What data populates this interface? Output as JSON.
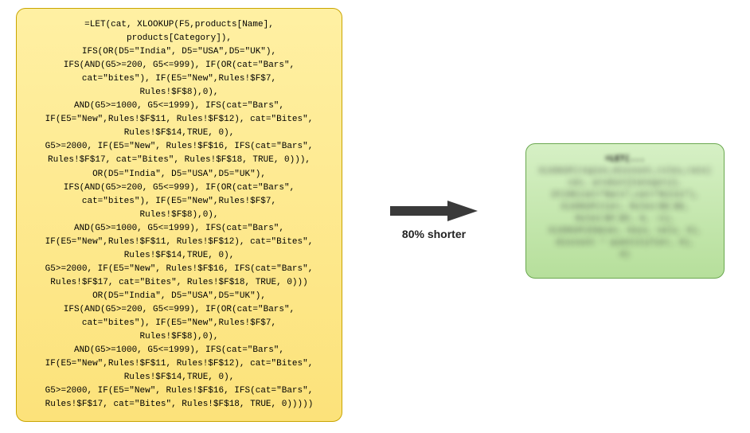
{
  "left_formula": {
    "lines": [
      "=LET(cat, XLOOKUP(F5,products[Name],",
      "products[Category]),",
      "IFS(OR(D5=\"India\", D5=\"USA\",D5=\"UK\"),",
      "IFS(AND(G5>=200, G5<=999), IF(OR(cat=\"Bars\",",
      "cat=\"bites\"), IF(E5=\"New\",Rules!$F$7,",
      "Rules!$F$8),0),",
      "AND(G5>=1000, G5<=1999), IFS(cat=\"Bars\",",
      "IF(E5=\"New\",Rules!$F$11, Rules!$F$12), cat=\"Bites\",",
      "Rules!$F$14,TRUE, 0),",
      "G5>=2000, IF(E5=\"New\", Rules!$F$16, IFS(cat=\"Bars\",",
      "Rules!$F$17, cat=\"Bites\", Rules!$F$18, TRUE, 0))),",
      "OR(D5=\"India\", D5=\"USA\",D5=\"UK\"),",
      "IFS(AND(G5>=200, G5<=999), IF(OR(cat=\"Bars\",",
      "cat=\"bites\"), IF(E5=\"New\",Rules!$F$7,",
      "Rules!$F$8),0),",
      "AND(G5>=1000, G5<=1999), IFS(cat=\"Bars\",",
      "IF(E5=\"New\",Rules!$F$11, Rules!$F$12), cat=\"Bites\",",
      "Rules!$F$14,TRUE, 0),",
      "G5>=2000, IF(E5=\"New\", Rules!$F$16, IFS(cat=\"Bars\",",
      "Rules!$F$17, cat=\"Bites\", Rules!$F$18, TRUE, 0)))",
      "OR(D5=\"India\", D5=\"USA\",D5=\"UK\"),",
      "IFS(AND(G5>=200, G5<=999), IF(OR(cat=\"Bars\",",
      "cat=\"bites\"), IF(E5=\"New\",Rules!$F$7,",
      "Rules!$F$8),0),",
      "AND(G5>=1000, G5<=1999), IFS(cat=\"Bars\",",
      "IF(E5=\"New\",Rules!$F$11, Rules!$F$12), cat=\"Bites\",",
      "Rules!$F$14,TRUE, 0),",
      "G5>=2000, IF(E5=\"New\", Rules!$F$16, IFS(cat=\"Bars\",",
      "Rules!$F$17, cat=\"Bites\", Rules!$F$18, TRUE, 0)))))"
    ]
  },
  "arrow": {
    "label": "80% shorter"
  },
  "right_formula": {
    "lines": [
      "=LET(...",
      "XLOOKUP(region,discount_rules,rate)",
      "cat, product[Category],",
      "IF(OR(cat=\"Bars\",cat=\"Bites\"),",
      "XLOOKUP(tier, Rules!$E:$E,",
      "Rules!$F:$F, 0, -1),",
      "XLOOKUP(E5&cat, keys, vals, 0),",
      "discount * quantityTier, 0),",
      "0)"
    ]
  }
}
